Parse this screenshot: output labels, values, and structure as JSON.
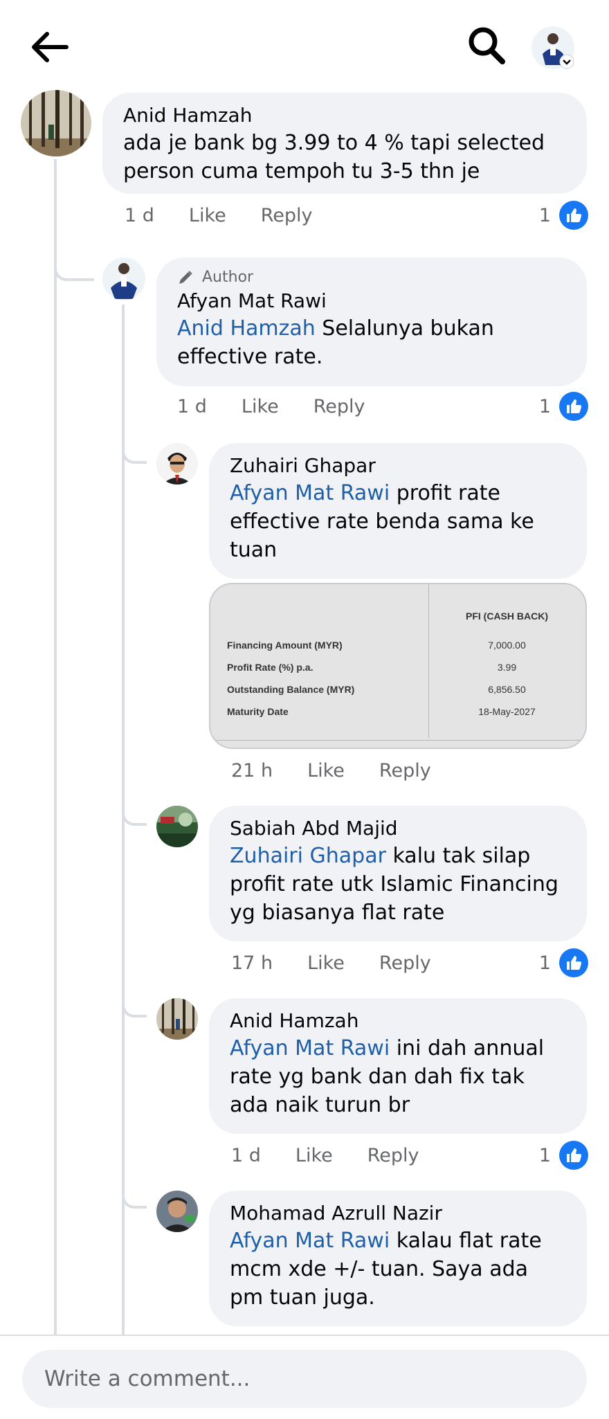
{
  "header": {
    "back_icon": "arrow-left-icon",
    "search_icon": "search-icon",
    "profile_icon": "profile-avatar-dropdown"
  },
  "colors": {
    "mention": "#1f5fa8",
    "like_badge": "#1877f2",
    "bubble": "#f0f2f5",
    "meta": "#65676b"
  },
  "comments": [
    {
      "name": "Anid Hamzah",
      "text": "ada je bank bg 3.99 to 4 % tapi selected person cuma tempoh tu 3-5 thn je",
      "time": "1 d",
      "like": "Like",
      "reply": "Reply",
      "likes": "1"
    },
    {
      "badge": "Author",
      "name": "Afyan Mat Rawi",
      "mention": "Anid Hamzah",
      "text": " Selalunya bukan effective rate.",
      "time": "1 d",
      "like": "Like",
      "reply": "Reply",
      "likes": "1"
    },
    {
      "name": "Zuhairi Ghapar",
      "mention": "Afyan Mat Rawi",
      "text": " profit rate effective rate benda sama ke tuan",
      "time": "21 h",
      "like": "Like",
      "reply": "Reply",
      "attachment": {
        "column_header": "PFI (CASH BACK)",
        "rows": [
          {
            "label": "Financing Amount (MYR)",
            "value": "7,000.00"
          },
          {
            "label": "Profit Rate (%) p.a.",
            "value": "3.99"
          },
          {
            "label": "Outstanding Balance (MYR)",
            "value": "6,856.50"
          },
          {
            "label": "Maturity Date",
            "value": "18-May-2027"
          }
        ]
      }
    },
    {
      "name": "Sabiah Abd Majid",
      "mention": "Zuhairi Ghapar",
      "text": " kalu tak silap profit rate utk Islamic Financing yg biasanya flat rate",
      "time": "17 h",
      "like": "Like",
      "reply": "Reply",
      "likes": "1"
    },
    {
      "name": "Anid Hamzah",
      "mention": "Afyan Mat Rawi",
      "text": " ini dah annual rate yg bank dan dah fix tak ada naik turun br",
      "time": "1 d",
      "like": "Like",
      "reply": "Reply",
      "likes": "1"
    },
    {
      "name": "Mohamad Azrull Nazir",
      "mention": "Afyan Mat Rawi",
      "text": " kalau flat rate mcm xde +/- tuan. Saya ada pm tuan juga."
    }
  ],
  "composer": {
    "placeholder": "Write a comment..."
  }
}
